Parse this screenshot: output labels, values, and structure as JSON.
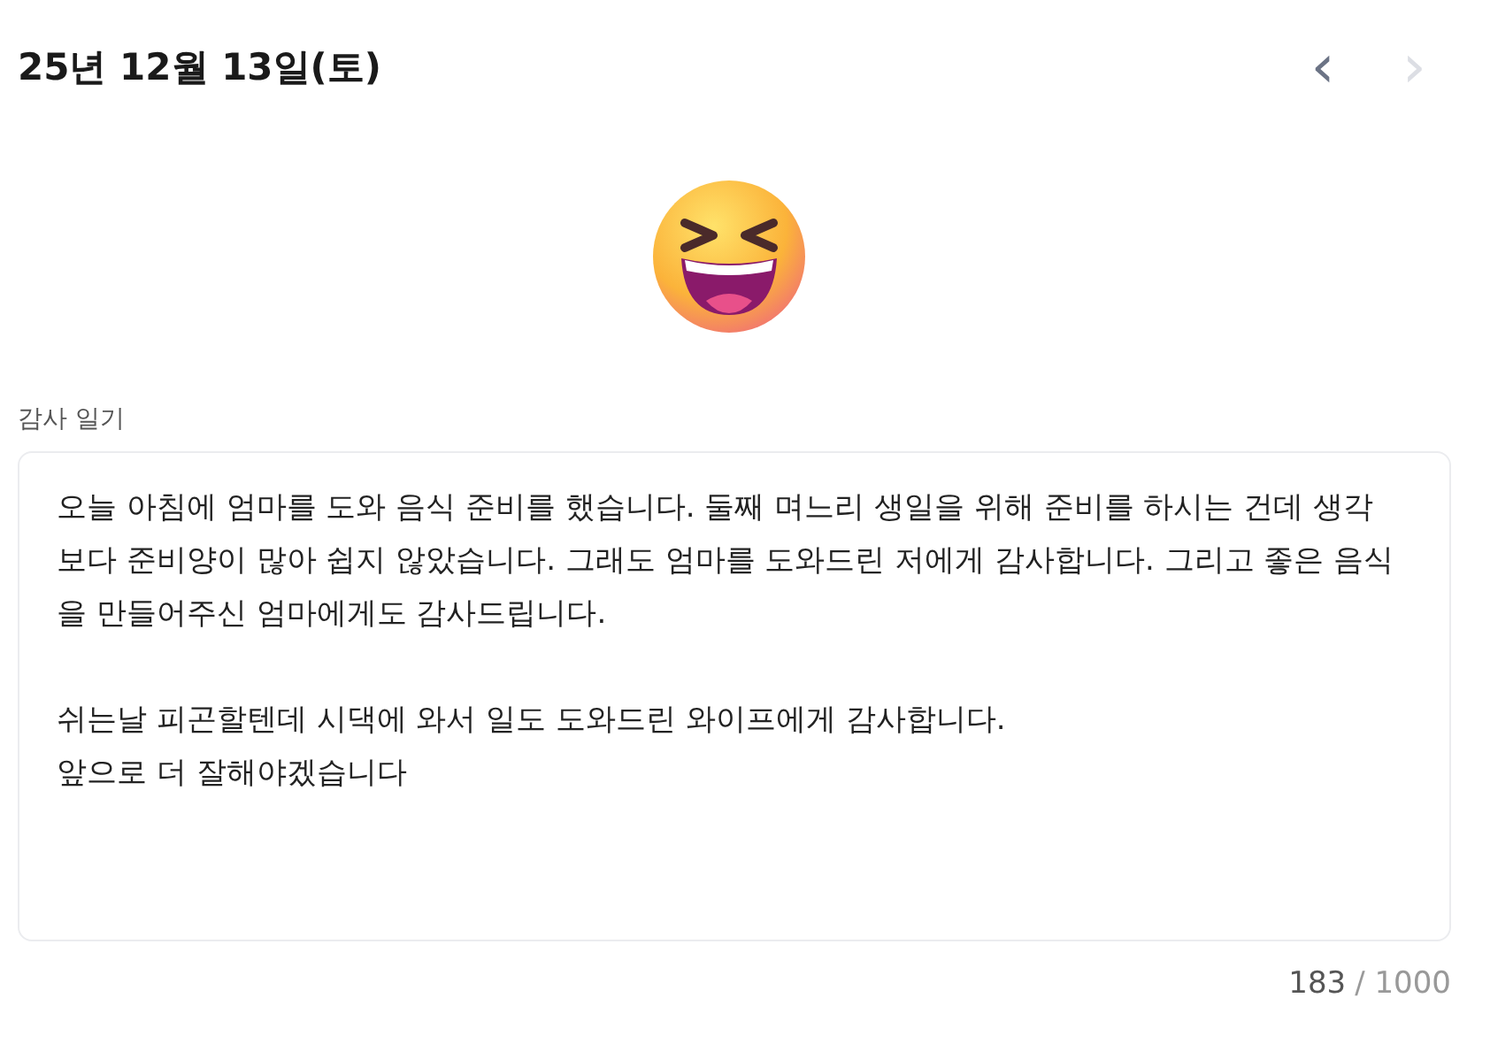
{
  "header": {
    "date": "25년 12월 13일(토)",
    "prev": {
      "label": "‹",
      "disabled": false
    },
    "next": {
      "label": "›",
      "disabled": true
    }
  },
  "mood": {
    "kind": "laughing"
  },
  "diary": {
    "label": "감사 일기",
    "value": "오늘 아침에 엄마를 도와 음식 준비를 했습니다. 둘째 며느리 생일을 위해 준비를 하시는 건데 생각보다 준비양이 많아 쉽지 않았습니다. 그래도 엄마를 도와드린 저에게 감사합니다. 그리고 좋은 음식을 만들어주신 엄마에게도 감사드립니다.\n\n쉬는날 피곤할텐데 시댁에 와서 일도 도와드린 와이프에게 감사합니다.\n앞으로 더 잘해야겠습니다",
    "count": "183",
    "limit": "/ 1000"
  }
}
